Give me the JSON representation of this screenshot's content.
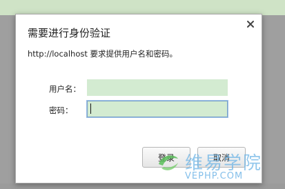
{
  "dialog": {
    "title": "需要进行身份验证",
    "message": "http://localhost 要求提供用户名和密码。",
    "close_icon": "close-icon",
    "username_label": "用户名：",
    "username_value": "",
    "password_label": "密码：",
    "password_value": "",
    "login_label": "登录",
    "cancel_label": "取消"
  },
  "watermark": {
    "text": "维易学院",
    "url": "VEPHP.COM",
    "logo_icon": "green-swirl-logo-icon"
  },
  "colors": {
    "input_fill": "#d3ebd1",
    "focus_border": "#7aa0c9",
    "watermark_blue": "#6eb4e6"
  }
}
